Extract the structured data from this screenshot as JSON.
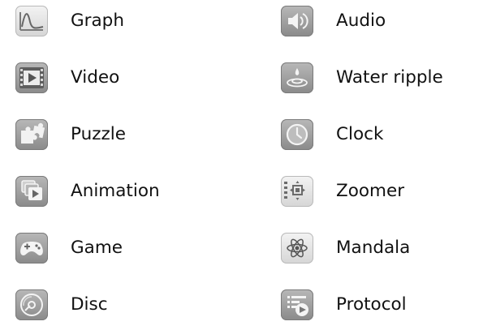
{
  "items": [
    {
      "label": "Graph",
      "icon": "graph-icon"
    },
    {
      "label": "Audio",
      "icon": "audio-icon"
    },
    {
      "label": "Video",
      "icon": "video-icon"
    },
    {
      "label": "Water ripple",
      "icon": "water-ripple-icon"
    },
    {
      "label": "Puzzle",
      "icon": "puzzle-icon"
    },
    {
      "label": "Clock",
      "icon": "clock-icon"
    },
    {
      "label": "Animation",
      "icon": "animation-icon"
    },
    {
      "label": "Zoomer",
      "icon": "zoomer-icon"
    },
    {
      "label": "Game",
      "icon": "game-icon"
    },
    {
      "label": "Mandala",
      "icon": "mandala-icon"
    },
    {
      "label": "Disc",
      "icon": "disc-icon"
    },
    {
      "label": "Protocol",
      "icon": "protocol-icon"
    }
  ]
}
